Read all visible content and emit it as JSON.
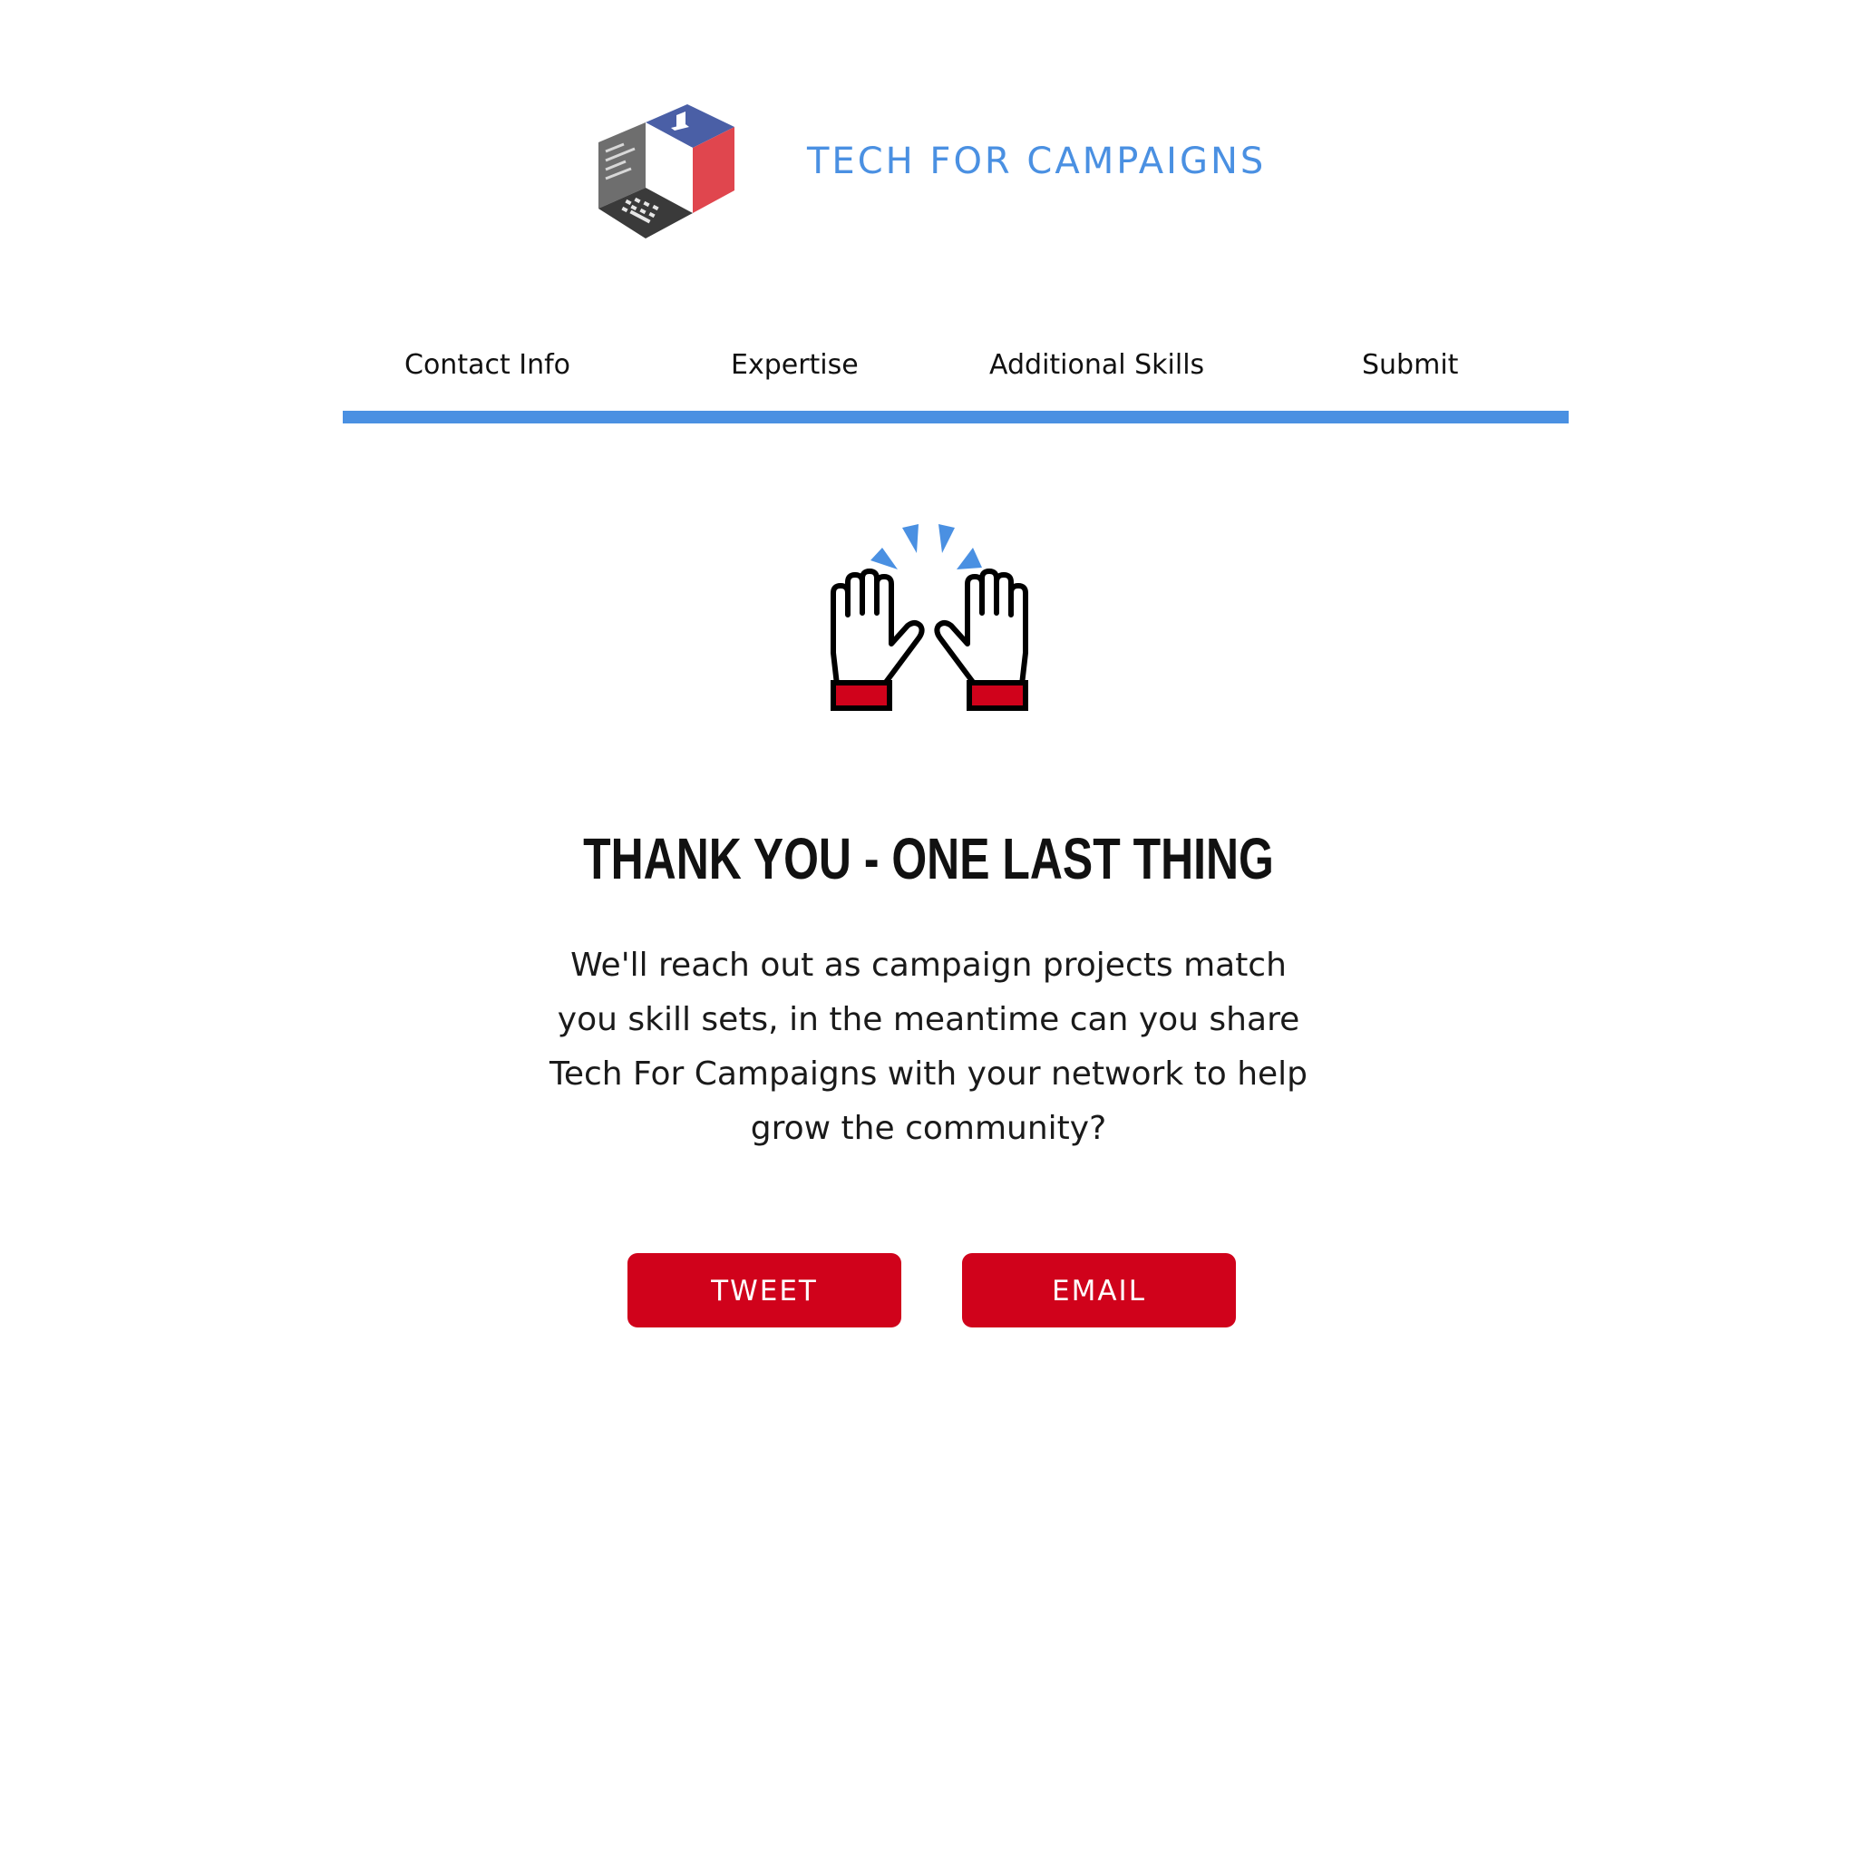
{
  "brand": {
    "logo_icon": "laptop-cube-logo-icon",
    "name": "TECH FOR CAMPAIGNS",
    "color": "#4a90e2"
  },
  "steps": {
    "items": [
      {
        "label": "Contact Info"
      },
      {
        "label": "Expertise"
      },
      {
        "label": "Additional Skills"
      },
      {
        "label": "Submit"
      }
    ],
    "progress": 1.0,
    "bar_color": "#4a90e2"
  },
  "celebration": {
    "icon": "raised-hands-icon",
    "accent_color": "#4a90e2",
    "cuff_color": "#d0021b"
  },
  "main": {
    "title": "THANK YOU - ONE LAST THING",
    "message": "We'll reach out as campaign projects match you skill sets, in the meantime can you share Tech For Campaigns with your network to help grow the community?"
  },
  "actions": {
    "tweet_label": "TWEET",
    "email_label": "EMAIL",
    "button_color": "#d0021b"
  }
}
